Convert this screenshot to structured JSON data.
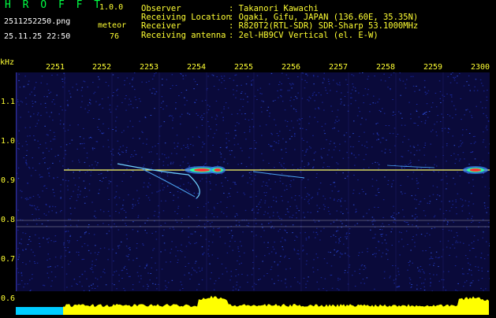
{
  "header": {
    "title": "H R O F F T",
    "version": "1.0.0",
    "filename": "2511252250.png",
    "meteor_label": "meteor",
    "datetime": "25.11.25 22:50",
    "meteor_count": "76"
  },
  "info": {
    "labels": "Observer\nReceiving Location\nReceiver\nReceiving antenna",
    "values": ": Takanori Kawachi\n: Ogaki, Gifu, JAPAN (136.60E, 35.35N)\n: R820T2(RTL-SDR) SDR-Sharp 53.1000MHz\n: 2el-HB9CV Vertical (el. E-W)"
  },
  "axes": {
    "y_unit": "kHz",
    "x_ticks": [
      "2251",
      "2252",
      "2253",
      "2254",
      "2255",
      "2256",
      "2257",
      "2258",
      "2259",
      "2300"
    ],
    "y_ticks": [
      "1.1",
      "1.0",
      "0.9",
      "0.8",
      "0.7",
      "0.6"
    ]
  },
  "colors": {
    "background": "#000000",
    "plot_bg": "#0a0a3a",
    "text_yellow": "#ffff33",
    "text_green": "#00ff44",
    "carrier": "#ffff66",
    "spectrum_fill": "#ffff00",
    "spectrum_base": "#00ccff"
  }
}
